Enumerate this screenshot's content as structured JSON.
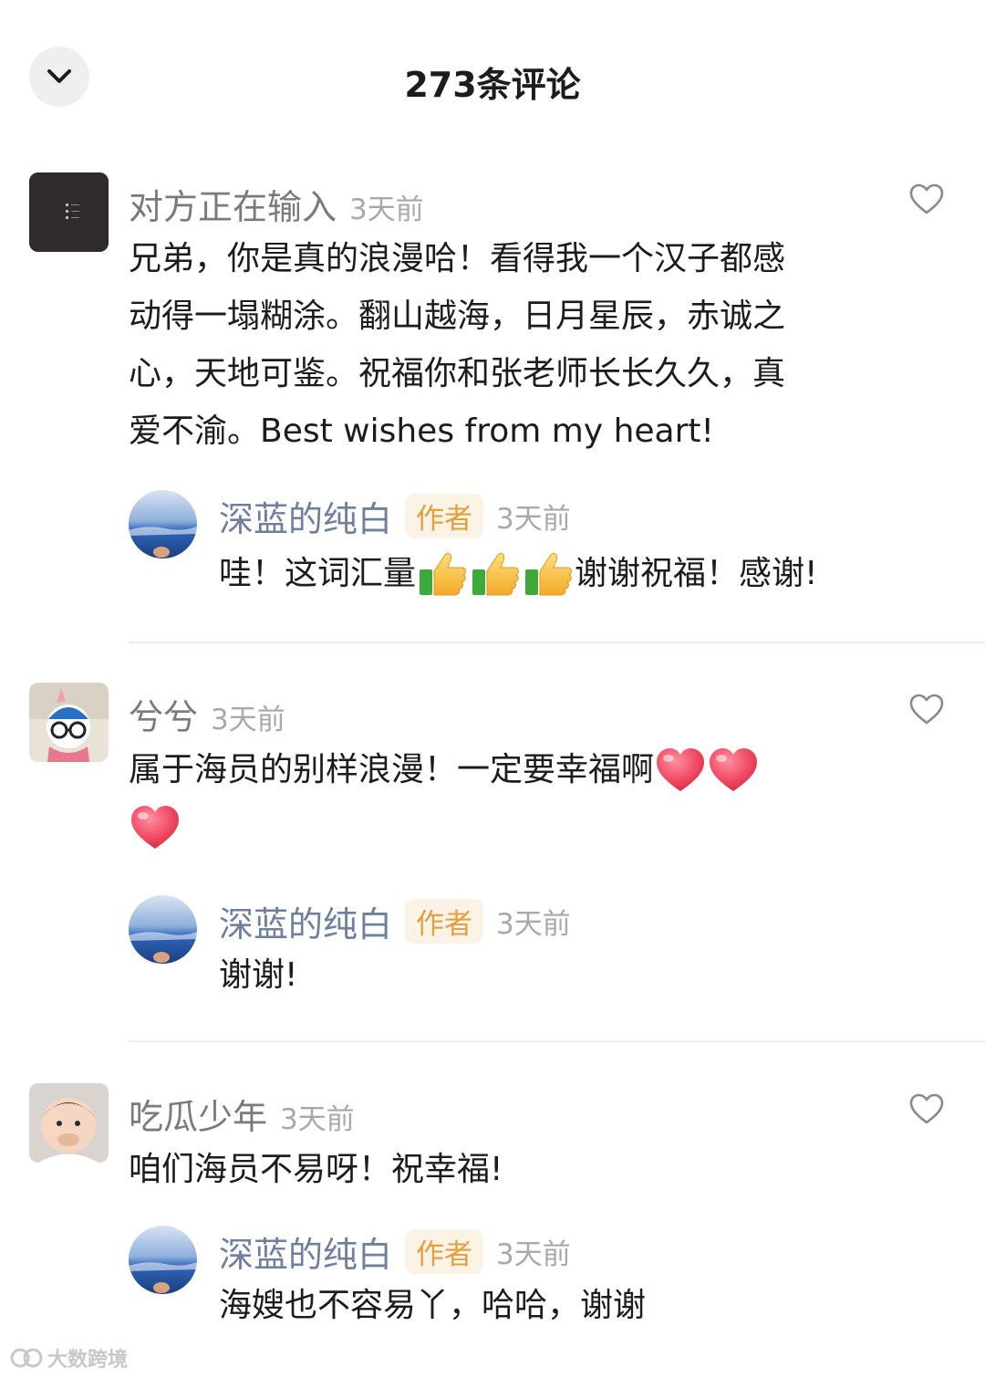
{
  "header": {
    "title": "273条评论",
    "back_icon": "chevron-down-icon"
  },
  "comments": [
    {
      "user": "对方正在输入",
      "time": "3天前",
      "lines": [
        "兄弟，你是真的浪漫哈！看得我一个汉子都感",
        "动得一塌糊涂。翻山越海，日月星辰，赤诚之",
        "心，天地可鉴。祝福你和张老师长长久久，真",
        "爱不渝。Best wishes from my heart!"
      ],
      "reply": {
        "user": "深蓝的纯白",
        "badge": "作者",
        "time": "3天前",
        "text_before": "哇！这词汇量",
        "text_after": "谢谢祝福！感谢!",
        "emoji": "thumbs-up-icon"
      }
    },
    {
      "user": "兮兮",
      "time": "3天前",
      "lines": [
        "属于海员的别样浪漫！一定要幸福啊"
      ],
      "emoji": "red-heart-icon",
      "reply": {
        "user": "深蓝的纯白",
        "badge": "作者",
        "time": "3天前",
        "text": "谢谢!"
      }
    },
    {
      "user": "吃瓜少年",
      "time": "3天前",
      "lines": [
        "咱们海员不易呀！祝幸福!"
      ],
      "reply": {
        "user": "深蓝的纯白",
        "badge": "作者",
        "time": "3天前",
        "text": "海嫂也不容易丫，哈哈，谢谢"
      }
    }
  ],
  "watermark": "大数跨境",
  "colors": {
    "reply_user": "#6e7fa0",
    "badge_text": "#e2a03f",
    "badge_bg": "#fbf3e5"
  }
}
